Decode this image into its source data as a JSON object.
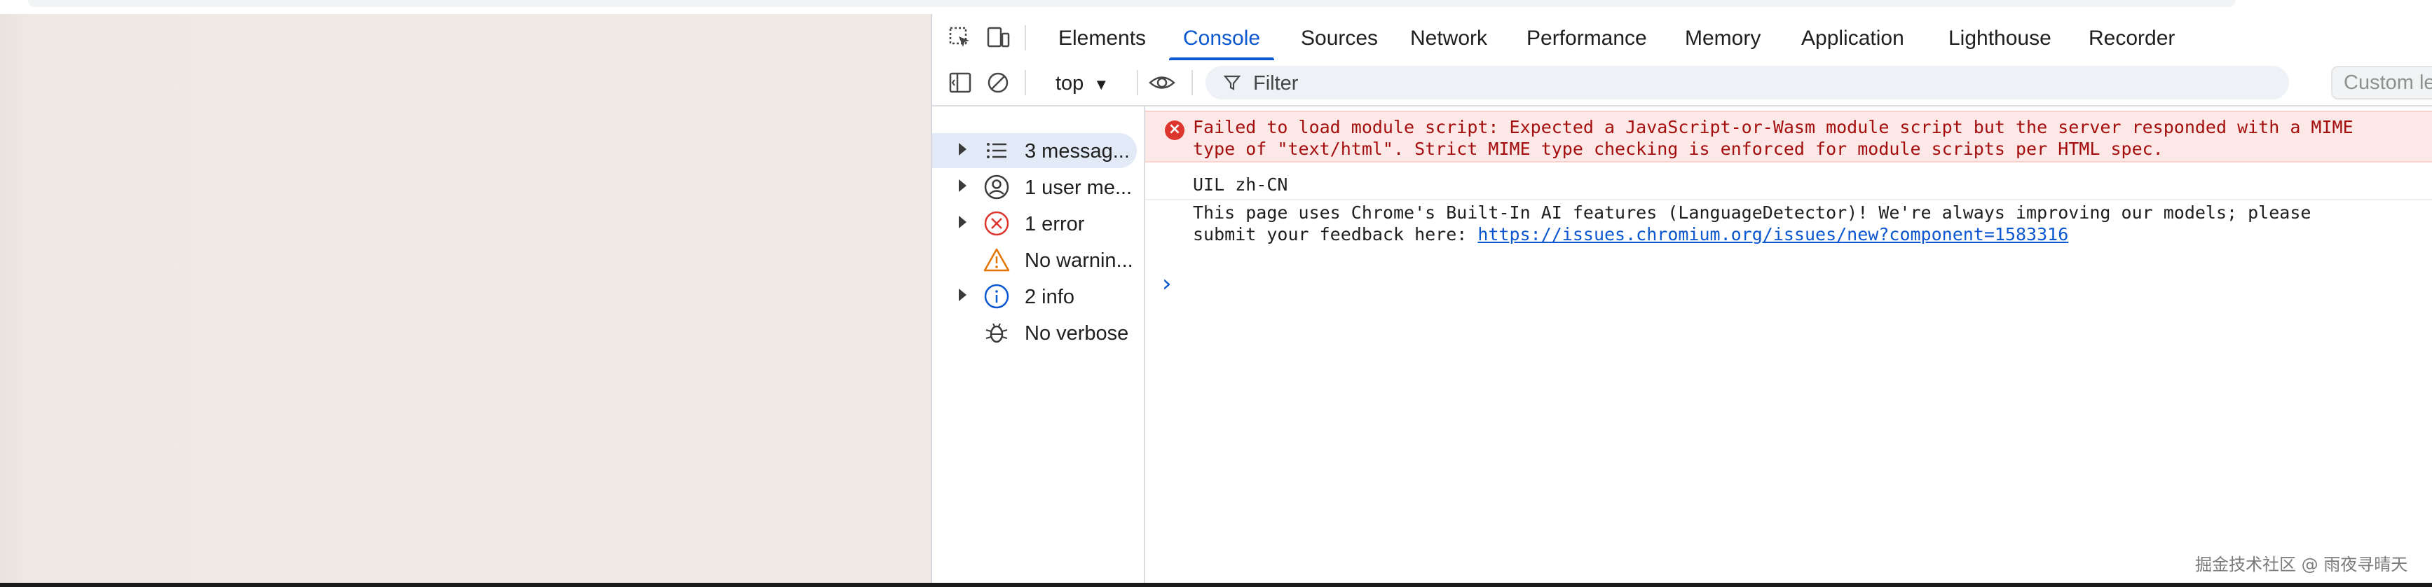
{
  "devtools": {
    "tabs": [
      {
        "label": "Elements"
      },
      {
        "label": "Console",
        "active": true
      },
      {
        "label": "Sources"
      },
      {
        "label": "Network"
      },
      {
        "label": "Performance"
      },
      {
        "label": "Memory"
      },
      {
        "label": "Application"
      },
      {
        "label": "Lighthouse"
      },
      {
        "label": "Recorder"
      }
    ],
    "toolbar_icons": [
      "inspect-element-icon",
      "device-toolbar-icon"
    ]
  },
  "console_toolbar": {
    "context": "top",
    "filter_placeholder": "Filter",
    "levels_label": "Custom le"
  },
  "sidebar": {
    "items": [
      {
        "label": "3 messag...",
        "icon": "list-icon",
        "selected": true
      },
      {
        "label": "1 user me...",
        "icon": "user-icon"
      },
      {
        "label": "1 error",
        "icon": "error-icon"
      },
      {
        "label": "No warnin...",
        "icon": "warning-icon"
      },
      {
        "label": "2 info",
        "icon": "info-icon"
      },
      {
        "label": "No verbose",
        "icon": "bug-icon"
      }
    ]
  },
  "messages": {
    "error_line1": "Failed to load module script: Expected a JavaScript-or-Wasm module script but the server responded with a MIME",
    "error_line2": "type of \"text/html\". Strict MIME type checking is enforced for module scripts per HTML spec.",
    "log1": "UIL zh-CN",
    "log2_line1": "This page uses Chrome's Built-In AI features (LanguageDetector)! We're always improving our models; please",
    "log2_line2_prefix": "submit your feedback here: ",
    "log2_link": "https://issues.chromium.org/issues/new?component=1583316",
    "prompt_symbol": "›"
  },
  "watermark": "掘金技术社区 @ 雨夜寻晴天",
  "colors": {
    "accent": "#0b57d0",
    "error_bg": "#fce8e6",
    "error_text": "#a50e0e",
    "warning": "#e37400"
  }
}
